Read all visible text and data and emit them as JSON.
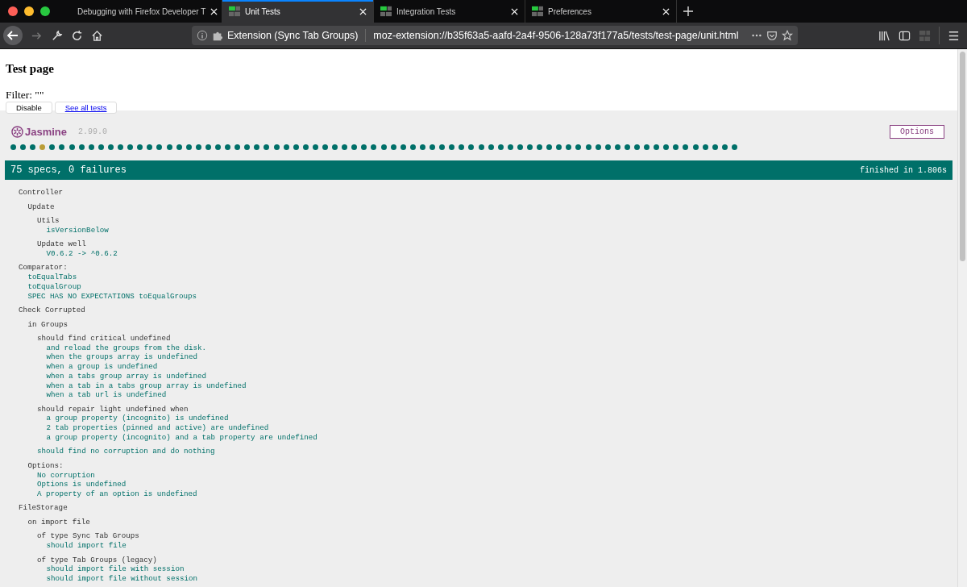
{
  "browser": {
    "tabs": [
      {
        "title": "Debugging with Firefox Developer T",
        "selected": false,
        "favicon": false
      },
      {
        "title": "Unit Tests",
        "selected": true,
        "favicon": true
      },
      {
        "title": "Integration Tests",
        "selected": false,
        "favicon": true
      },
      {
        "title": "Preferences",
        "selected": false,
        "favicon": true
      }
    ],
    "identity": "Extension (Sync Tab Groups)",
    "url": "moz-extension://b35f63a5-aafd-2a4f-9506-128a73f177a5/tests/test-page/unit.html"
  },
  "page": {
    "title": "Test page",
    "filter": "Filter: \"\"",
    "buttons": [
      "Disable",
      "See all tests"
    ]
  },
  "jasmine": {
    "logo": "Jasmine",
    "version": "2.99.0",
    "options": "Options",
    "dots": [
      {
        "kind": "passed"
      },
      {
        "kind": "passed"
      },
      {
        "kind": "passed"
      },
      {
        "kind": "pending"
      },
      {
        "kind": "passed"
      },
      {
        "kind": "passed"
      },
      {
        "kind": "passed"
      },
      {
        "kind": "passed"
      },
      {
        "kind": "passed"
      },
      {
        "kind": "passed"
      },
      {
        "kind": "passed"
      },
      {
        "kind": "passed"
      },
      {
        "kind": "passed"
      },
      {
        "kind": "passed"
      },
      {
        "kind": "passed"
      },
      {
        "kind": "passed"
      },
      {
        "kind": "passed"
      },
      {
        "kind": "passed"
      },
      {
        "kind": "passed"
      },
      {
        "kind": "passed"
      },
      {
        "kind": "passed"
      },
      {
        "kind": "passed"
      },
      {
        "kind": "passed"
      },
      {
        "kind": "passed"
      },
      {
        "kind": "passed"
      },
      {
        "kind": "passed"
      },
      {
        "kind": "passed"
      },
      {
        "kind": "passed"
      },
      {
        "kind": "passed"
      },
      {
        "kind": "passed"
      },
      {
        "kind": "passed"
      },
      {
        "kind": "passed"
      },
      {
        "kind": "passed"
      },
      {
        "kind": "passed"
      },
      {
        "kind": "passed"
      },
      {
        "kind": "passed"
      },
      {
        "kind": "passed"
      },
      {
        "kind": "passed"
      },
      {
        "kind": "passed"
      },
      {
        "kind": "passed"
      },
      {
        "kind": "passed"
      },
      {
        "kind": "passed"
      },
      {
        "kind": "passed"
      },
      {
        "kind": "passed"
      },
      {
        "kind": "passed"
      },
      {
        "kind": "passed"
      },
      {
        "kind": "passed"
      },
      {
        "kind": "passed"
      },
      {
        "kind": "passed"
      },
      {
        "kind": "passed"
      },
      {
        "kind": "passed"
      },
      {
        "kind": "passed"
      },
      {
        "kind": "passed"
      },
      {
        "kind": "passed"
      },
      {
        "kind": "passed"
      },
      {
        "kind": "passed"
      },
      {
        "kind": "passed"
      },
      {
        "kind": "passed"
      },
      {
        "kind": "passed"
      },
      {
        "kind": "passed"
      },
      {
        "kind": "passed"
      },
      {
        "kind": "passed"
      },
      {
        "kind": "passed"
      },
      {
        "kind": "passed"
      },
      {
        "kind": "passed"
      },
      {
        "kind": "passed"
      },
      {
        "kind": "passed"
      },
      {
        "kind": "passed"
      },
      {
        "kind": "passed"
      },
      {
        "kind": "passed"
      },
      {
        "kind": "passed"
      },
      {
        "kind": "passed"
      },
      {
        "kind": "passed"
      },
      {
        "kind": "passed"
      },
      {
        "kind": "passed"
      }
    ],
    "summary": "75 specs, 0 failures",
    "duration": "finished in 1.806s",
    "results": [
      {
        "kind": "suite",
        "name": "Controller",
        "children": [
          {
            "kind": "suite",
            "name": "Update",
            "children": [
              {
                "kind": "suite",
                "name": "Utils",
                "children": [
                  {
                    "kind": "spec",
                    "name": "isVersionBelow"
                  }
                ]
              },
              {
                "kind": "suite",
                "name": "Update well",
                "children": [
                  {
                    "kind": "spec",
                    "name": "V0.6.2 -> ^0.6.2"
                  }
                ]
              }
            ]
          }
        ]
      },
      {
        "kind": "suite",
        "name": "Comparator:",
        "children": [
          {
            "kind": "spec",
            "name": "toEqualTabs"
          },
          {
            "kind": "spec",
            "name": "toEqualGroup"
          },
          {
            "kind": "spec",
            "name": "SPEC HAS NO EXPECTATIONS toEqualGroups"
          }
        ]
      },
      {
        "kind": "suite",
        "name": "Check Corrupted",
        "children": [
          {
            "kind": "suite",
            "name": "in Groups",
            "children": [
              {
                "kind": "suite",
                "name": "should find critical undefined",
                "children": [
                  {
                    "kind": "spec",
                    "name": "and reload the groups from the disk."
                  },
                  {
                    "kind": "spec",
                    "name": "when the groups array is undefined"
                  },
                  {
                    "kind": "spec",
                    "name": "when a group is undefined"
                  },
                  {
                    "kind": "spec",
                    "name": "when a tabs group array is undefined"
                  },
                  {
                    "kind": "spec",
                    "name": "when a tab in a tabs group array is undefined"
                  },
                  {
                    "kind": "spec",
                    "name": "when a tab url is undefined"
                  }
                ]
              },
              {
                "kind": "suite",
                "name": "should repair light undefined when",
                "children": [
                  {
                    "kind": "spec",
                    "name": "a group property (incognito) is undefined"
                  },
                  {
                    "kind": "spec",
                    "name": "2 tab properties (pinned and active) are undefined"
                  },
                  {
                    "kind": "spec",
                    "name": "a group property (incognito) and a tab property are undefined"
                  }
                ]
              },
              {
                "kind": "spec",
                "name": "should find no corruption and do nothing"
              }
            ]
          },
          {
            "kind": "suite",
            "name": "Options:",
            "children": [
              {
                "kind": "spec",
                "name": "No corruption"
              },
              {
                "kind": "spec",
                "name": "Options is undefined"
              },
              {
                "kind": "spec",
                "name": "A property of an option is undefined"
              }
            ]
          }
        ]
      },
      {
        "kind": "suite",
        "name": "FileStorage",
        "children": [
          {
            "kind": "suite",
            "name": "on import file",
            "children": [
              {
                "kind": "suite",
                "name": "of type Sync Tab Groups",
                "children": [
                  {
                    "kind": "spec",
                    "name": "should import file"
                  }
                ]
              },
              {
                "kind": "suite",
                "name": "of type Tab Groups (legacy)",
                "children": [
                  {
                    "kind": "spec",
                    "name": "should import file with session"
                  },
                  {
                    "kind": "spec",
                    "name": "should import file without session"
                  }
                ]
              }
            ]
          }
        ]
      }
    ]
  }
}
